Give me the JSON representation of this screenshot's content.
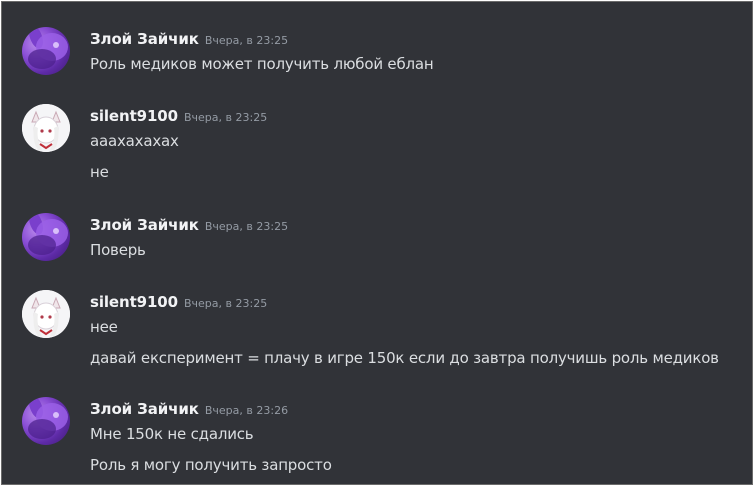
{
  "colors": {
    "background": "#313338",
    "username": "#f2f3f5",
    "timestamp": "#949ba4",
    "message_text": "#dbdee1"
  },
  "messages": [
    {
      "author": "Злой Зайчик",
      "avatar_icon": "purple-bunny-avatar",
      "time": "Вчера, в 23:25",
      "lines": [
        "Роль медиков может получить любой еблан"
      ]
    },
    {
      "author": "silent9100",
      "avatar_icon": "white-fox-girl-avatar",
      "time": "Вчера, в 23:25",
      "lines": [
        "ааахахахах",
        "не"
      ]
    },
    {
      "author": "Злой Зайчик",
      "avatar_icon": "purple-bunny-avatar",
      "time": "Вчера, в 23:25",
      "lines": [
        "Поверь"
      ]
    },
    {
      "author": "silent9100",
      "avatar_icon": "white-fox-girl-avatar",
      "time": "Вчера, в 23:25",
      "lines": [
        "нее",
        "давай експеримент = плачу в игре 150к если до завтра получишь роль медиков"
      ]
    },
    {
      "author": "Злой Зайчик",
      "avatar_icon": "purple-bunny-avatar",
      "time": "Вчера, в 23:26",
      "lines": [
        "Мне 150к не сдались",
        "Роль я могу получить запросто"
      ]
    }
  ]
}
